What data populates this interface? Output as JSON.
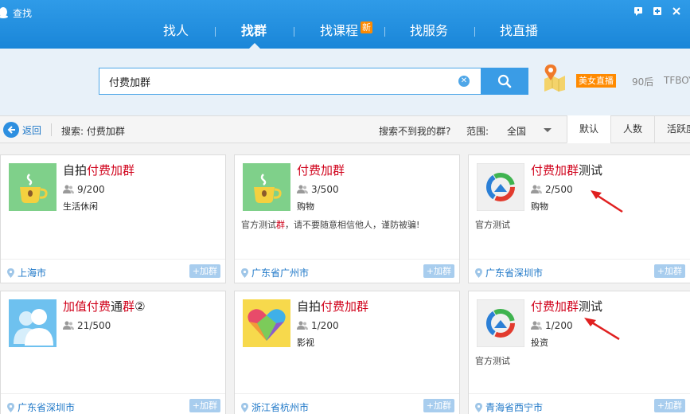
{
  "window": {
    "title": "查找"
  },
  "nav": {
    "items": [
      {
        "label": "找人",
        "active": false
      },
      {
        "label": "找群",
        "active": true
      },
      {
        "label": "找课程",
        "active": false,
        "badge": "新"
      },
      {
        "label": "找服务",
        "active": false
      },
      {
        "label": "找直播",
        "active": false
      }
    ]
  },
  "search": {
    "value": "付费加群",
    "clear_icon": "clear-icon",
    "button_icon": "search-icon"
  },
  "hot_tags": [
    "美女直播",
    "90后",
    "TFBOY"
  ],
  "filterbar": {
    "back_label": "返回",
    "search_summary": "搜索: 付费加群",
    "not_found_label": "搜索不到我的群?",
    "range_label": "范围:",
    "range_value": "全国",
    "sort_tabs": [
      {
        "label": "默认",
        "active": true
      },
      {
        "label": "人数",
        "active": false
      },
      {
        "label": "活跃度",
        "active": false
      }
    ]
  },
  "results": [
    {
      "name_pre": "自拍",
      "name_hl": "付费加群",
      "name_post": "",
      "members": "9/200",
      "category": "生活休闲",
      "desc_pre": "",
      "desc_hl": "",
      "desc_post": "",
      "location": "上海市",
      "join_label": "+加群",
      "avatar": "coffee-cup"
    },
    {
      "name_pre": "",
      "name_hl": "付费加群",
      "name_post": "",
      "members": "3/500",
      "category": "购物",
      "desc_pre": "官方测试",
      "desc_hl": "群",
      "desc_post": "，请不要随意相信他人，谨防被骗!",
      "location": "广东省广州市",
      "join_label": "+加群",
      "avatar": "coffee-cup"
    },
    {
      "name_pre": "",
      "name_hl": "付费加群",
      "name_post": "测试",
      "members": "2/500",
      "category": "购物",
      "desc_pre": "官方测试",
      "desc_hl": "",
      "desc_post": "",
      "location": "广东省深圳市",
      "join_label": "+加群",
      "avatar": "ring-logo"
    },
    {
      "name_pre": "加值",
      "name_hl": "付费",
      "name_mid": "通",
      "name_hl2": "群",
      "name_post": "②",
      "members": "21/500",
      "category": "",
      "desc_pre": "",
      "desc_hl": "",
      "desc_post": "",
      "location": "广东省深圳市",
      "join_label": "+加群",
      "avatar": "default-group"
    },
    {
      "name_pre": "自拍",
      "name_hl": "付费加群",
      "name_post": "",
      "members": "1/200",
      "category": "影视",
      "desc_pre": "",
      "desc_hl": "",
      "desc_post": "",
      "location": "浙江省杭州市",
      "join_label": "+加群",
      "avatar": "heart-logo"
    },
    {
      "name_pre": "",
      "name_hl": "付费加群",
      "name_post": "测试",
      "members": "1/200",
      "category": "投资",
      "desc_pre": "官方测试",
      "desc_hl": "",
      "desc_post": "",
      "location": "青海省西宁市",
      "join_label": "+加群",
      "avatar": "ring-logo"
    }
  ],
  "colors": {
    "accent": "#1f8ee0",
    "highlight": "#d0021b",
    "badge": "#ff8a00",
    "arrow": "#e02020"
  }
}
